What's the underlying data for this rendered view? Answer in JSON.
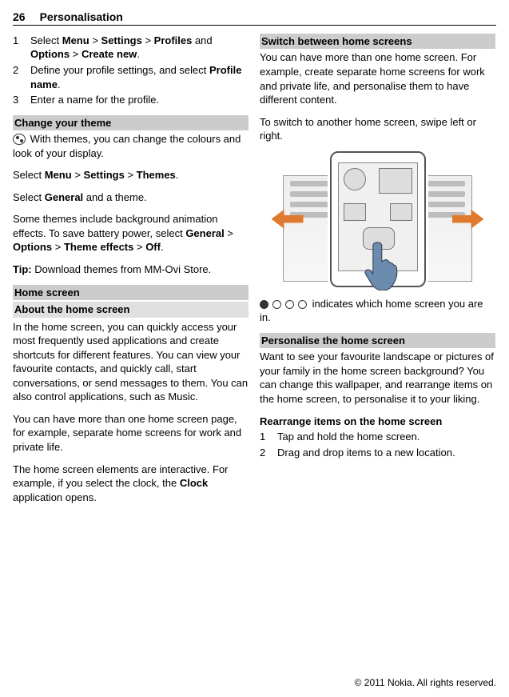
{
  "header": {
    "page_num": "26",
    "chapter": "Personalisation"
  },
  "left": {
    "steps_a": [
      {
        "n": "1",
        "pre": "Select ",
        "b1": "Menu",
        "mid1": " > ",
        "b2": "Settings",
        "mid2": " > ",
        "b3": "Profiles",
        "mid3": " and ",
        "b4": "Options",
        "mid4": " > ",
        "b5": "Create new",
        "post": "."
      },
      {
        "n": "2",
        "pre": "Define your profile settings, and select ",
        "b1": "Profile name",
        "post": "."
      },
      {
        "n": "3",
        "pre": "Enter a name for the profile.",
        "post": ""
      }
    ],
    "sec_theme": "Change your theme",
    "theme_p1": " With themes, you can change the colours and look of your display.",
    "theme_p2_pre": "Select ",
    "theme_p2_b1": "Menu",
    "theme_p2_m1": " > ",
    "theme_p2_b2": "Settings",
    "theme_p2_m2": " > ",
    "theme_p2_b3": "Themes",
    "theme_p2_post": ".",
    "theme_p3_pre": "Select ",
    "theme_p3_b1": "General",
    "theme_p3_post": " and a theme.",
    "theme_p4_pre": "Some themes include background animation effects. To save battery power, select ",
    "theme_p4_b1": "General",
    "theme_p4_m1": " > ",
    "theme_p4_b2": "Options",
    "theme_p4_m2": " > ",
    "theme_p4_b3": "Theme effects",
    "theme_p4_m3": " > ",
    "theme_p4_b4": "Off",
    "theme_p4_post": ".",
    "tip_label": "Tip:",
    "tip_txt": " Download themes from MM-Ovi Store.",
    "sec_home": "Home screen",
    "sub_about": "About the home screen",
    "about_p1": "In the home screen, you can quickly access your most frequently used applications and create shortcuts for different features. You can view your favourite contacts, and quickly call, start conversations, or send messages to them. You can also control applications, such as Music.",
    "about_p2": "You can have more than one home screen page, for example, separate home screens for work and private life.",
    "about_p3_pre": "The home screen elements are interactive. For example, if you select the clock, the ",
    "about_p3_b1": "Clock",
    "about_p3_post": " application opens."
  },
  "right": {
    "sec_switch": "Switch between home screens",
    "switch_p1": "You can have more than one home screen. For example, create separate home screens for work and private life, and personalise them to have different content.",
    "switch_p2": "To switch to another home screen, swipe left or right.",
    "dots_txt": " indicates which home screen you are in.",
    "sec_pers": "Personalise the home screen",
    "pers_p1": "Want to see your favourite landscape or pictures of your family in the home screen background? You can change this wallpaper, and rearrange items on the home screen, to personalise it to your liking.",
    "rearr_title": "Rearrange items on the home screen",
    "steps_b": [
      {
        "n": "1",
        "txt": "Tap and hold the home screen."
      },
      {
        "n": "2",
        "txt": "Drag and drop items to a new location."
      }
    ]
  },
  "footer": "© 2011 Nokia. All rights reserved."
}
